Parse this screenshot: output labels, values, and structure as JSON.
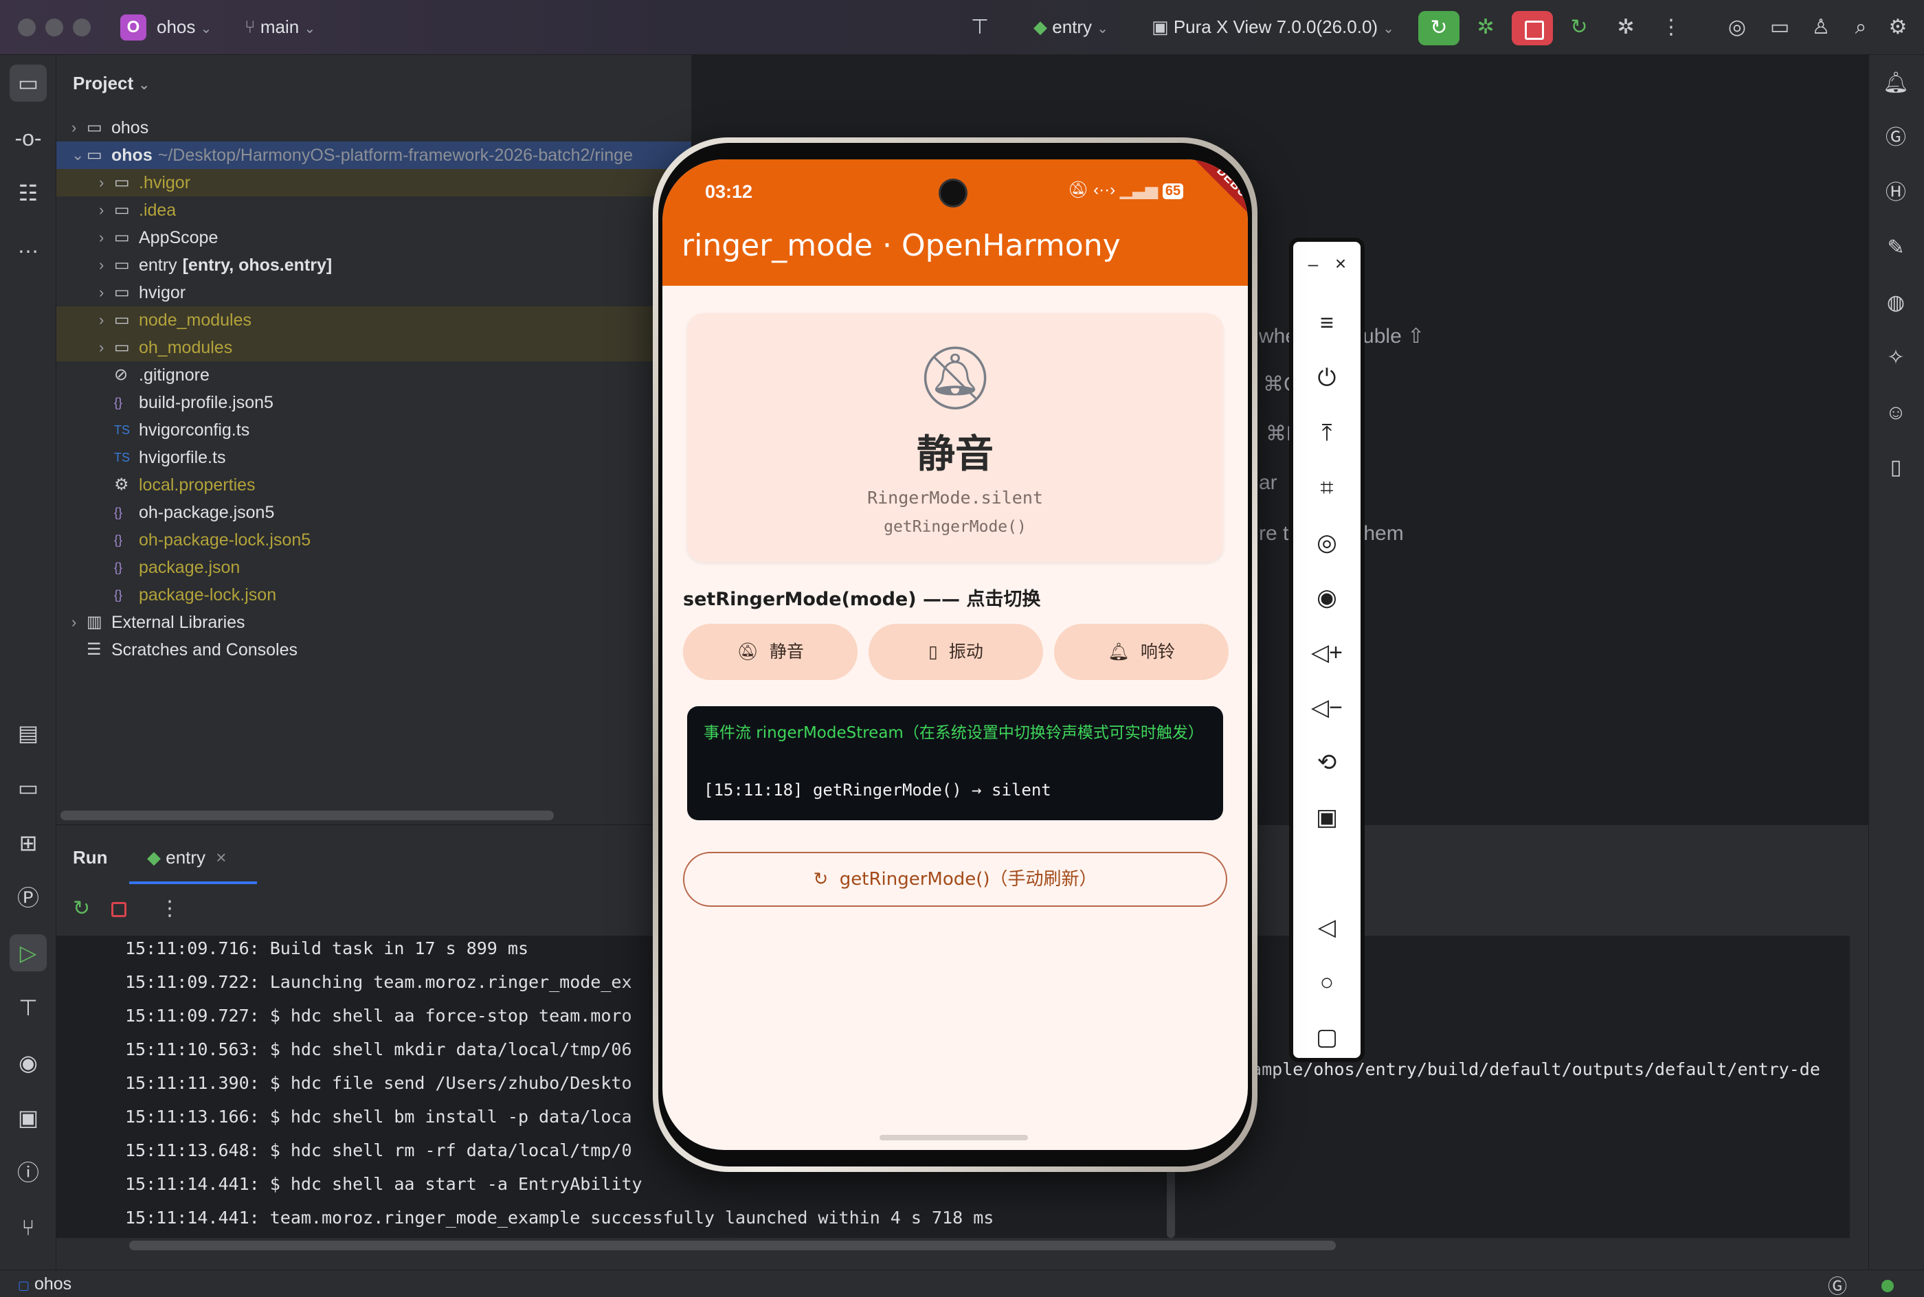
{
  "titlebar": {
    "project_badge": "O",
    "project_name": "ohos",
    "branch": "main",
    "run_config": "entry",
    "device": "Pura X View 7.0.0(26.0.0)"
  },
  "project_panel": {
    "title": "Project",
    "items": [
      {
        "label": "ohos",
        "suffix": "",
        "icon": "module-folder-icon",
        "style": "norm",
        "expanded": false
      },
      {
        "label": "ohos",
        "suffix": "~/Desktop/HarmonyOS-platform-framework-2026-batch2/ringe",
        "icon": "module-folder-icon",
        "style": "sel",
        "expanded": true
      },
      {
        "label": ".hvigor",
        "suffix": "",
        "icon": "folder-icon",
        "style": "ign",
        "expanded": false
      },
      {
        "label": ".idea",
        "suffix": "",
        "icon": "folder-icon",
        "style": "ignt",
        "expanded": false
      },
      {
        "label": "AppScope",
        "suffix": "",
        "icon": "folder-icon",
        "style": "norm",
        "expanded": false
      },
      {
        "label": "entry",
        "suffix": "[entry, ohos.entry]",
        "icon": "module-folder-icon",
        "style": "norm",
        "expanded": false
      },
      {
        "label": "hvigor",
        "suffix": "",
        "icon": "folder-icon",
        "style": "norm",
        "expanded": false
      },
      {
        "label": "node_modules",
        "suffix": "",
        "icon": "folder-icon",
        "style": "ign",
        "expanded": false
      },
      {
        "label": "oh_modules",
        "suffix": "",
        "icon": "folder-icon",
        "style": "ign",
        "expanded": false
      },
      {
        "label": ".gitignore",
        "suffix": "",
        "icon": "ignore-file-icon",
        "style": "norm"
      },
      {
        "label": "build-profile.json5",
        "suffix": "",
        "icon": "json-file-icon",
        "style": "norm"
      },
      {
        "label": "hvigorconfig.ts",
        "suffix": "",
        "icon": "ts-file-icon",
        "style": "norm"
      },
      {
        "label": "hvigorfile.ts",
        "suffix": "",
        "icon": "ts-file-icon",
        "style": "norm"
      },
      {
        "label": "local.properties",
        "suffix": "",
        "icon": "settings-file-icon",
        "style": "ignt"
      },
      {
        "label": "oh-package.json5",
        "suffix": "",
        "icon": "json-file-icon",
        "style": "norm"
      },
      {
        "label": "oh-package-lock.json5",
        "suffix": "",
        "icon": "json-file-icon",
        "style": "ignt"
      },
      {
        "label": "package.json",
        "suffix": "",
        "icon": "json-file-icon",
        "style": "ignt"
      },
      {
        "label": "package-lock.json",
        "suffix": "",
        "icon": "json-file-icon",
        "style": "ignt"
      },
      {
        "label": "External Libraries",
        "suffix": "",
        "icon": "library-icon",
        "style": "norm",
        "expanded": false
      },
      {
        "label": "Scratches and Consoles",
        "suffix": "",
        "icon": "scratches-icon",
        "style": "norm"
      }
    ]
  },
  "editor_hints": {
    "line1_a": "whe",
    "line1_b": "uble ⇧",
    "line2": "⌘C",
    "line3": "⌘E",
    "line4": "ar",
    "line5_a": "re to",
    "line5_b": "them"
  },
  "run_panel": {
    "title": "Run",
    "tab_label": "entry",
    "console_lines": [
      "15:11:09.716: Build task in 17 s 899 ms",
      "15:11:09.722: Launching team.moroz.ringer_mode_ex",
      "15:11:09.727: $ hdc shell aa force-stop team.moro",
      "15:11:10.563: $ hdc shell mkdir data/local/tmp/06",
      "15:11:11.390: $ hdc file send /Users/zhubo/Deskto",
      "15:11:13.166: $ hdc shell bm install -p data/loca",
      "15:11:13.648: $ hdc shell rm -rf data/local/tmp/0",
      "15:11:14.441: $ hdc shell aa start -a EntryAbility",
      "15:11:14.441: team.moroz.ringer_mode_example successfully launched within 4 s 718 ms"
    ],
    "console_tail": "xample/ohos/entry/build/default/outputs/default/entry-de"
  },
  "statusbar": {
    "project": "ohos"
  },
  "phone": {
    "time": "03:12",
    "battery": "65",
    "debug_label": "DEBUG",
    "app_title": "ringer_mode · OpenHarmony",
    "mode_title": "静音",
    "mode_enum": "RingerMode.silent",
    "mode_getter": "getRingerMode()",
    "section_label": "setRingerMode(mode) —— 点击切换",
    "buttons": [
      {
        "label": "静音",
        "icon": "bell-off-icon"
      },
      {
        "label": "振动",
        "icon": "vibrate-icon"
      },
      {
        "label": "响铃",
        "icon": "bell-ring-icon"
      }
    ],
    "stream_title": "事件流 ringerModeStream（在系统设置中切换铃声模式可实时触发）",
    "stream_log": "[15:11:18] getRingerMode() → silent",
    "refresh_label": "getRingerMode()（手动刷新）",
    "colors": {
      "appbar": "#e8620a",
      "background": "#fff4f0",
      "stream_title": "#3fd65a"
    }
  }
}
